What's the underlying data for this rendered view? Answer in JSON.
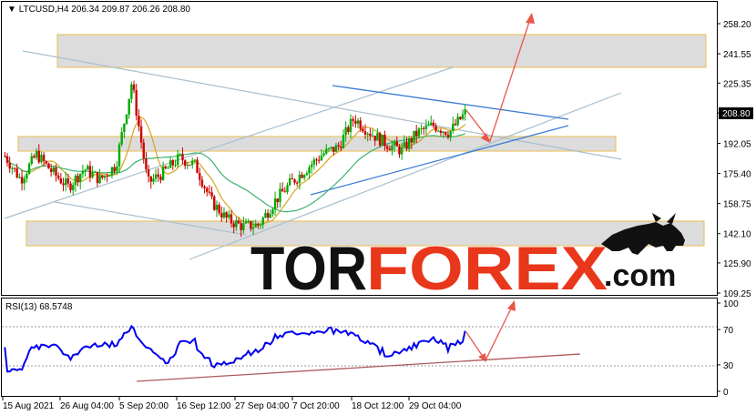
{
  "header": {
    "symbol_line": "LTCUSD,H4  206.34 209.87 206.26 208.80",
    "rsi_label": "RSI(13) 68.5748"
  },
  "price_panel": {
    "y_ticks": [
      "258.20",
      "241.55",
      "225.35",
      "208.80",
      "192.05",
      "175.40",
      "158.75",
      "142.10",
      "125.90",
      "109.25"
    ],
    "current_price": "208.80"
  },
  "rsi_panel": {
    "y_ticks": [
      "100",
      "70",
      "30",
      "0"
    ],
    "levels": [
      70,
      30
    ]
  },
  "x_ticks": [
    "15 Aug 2021",
    "26 Aug 04:00",
    "5 Sep 20:00",
    "16 Sep 12:00",
    "27 Sep 04:00",
    "7 Oct 20:00",
    "18 Oct 12:00",
    "29 Oct 04:00"
  ],
  "watermark": {
    "part1": "TOR",
    "part2": "FOREX",
    "part3": ".com"
  },
  "colors": {
    "bull": "#00aa00",
    "bear": "#cc0000",
    "ma_fast": "#d9a520",
    "ma_slow": "#3cb371",
    "channel": "#a8bfcf",
    "trend_blue": "#3a7bd5",
    "arrow": "#e8574a",
    "zone_fill": "#dcdcdc",
    "zone_border": "#e8c46a",
    "rsi_line": "#0000ee",
    "rsi_trend": "#b05a5a",
    "logo_dark": "#111111",
    "logo_red": "#e8371a"
  },
  "chart_data": {
    "type": "candlestick",
    "symbol": "LTCUSD",
    "timeframe": "H4",
    "ohlc_last": {
      "open": 206.34,
      "high": 209.87,
      "low": 206.26,
      "close": 208.8
    },
    "x": [
      "15 Aug 2021",
      "26 Aug 04:00",
      "5 Sep 20:00",
      "16 Sep 12:00",
      "27 Sep 04:00",
      "7 Oct 20:00",
      "18 Oct 12:00",
      "29 Oct 04:00"
    ],
    "close_approx": [
      185,
      172,
      186,
      176,
      168,
      178,
      172,
      180,
      226,
      170,
      176,
      184,
      180,
      160,
      150,
      146,
      147,
      160,
      170,
      178,
      186,
      190,
      206,
      198,
      192,
      188,
      198,
      202,
      198,
      208.8
    ],
    "ylim": [
      109.25,
      258.2
    ],
    "resistance_zones": [
      [
        235.5,
        257.6
      ],
      [
        187.8,
        196.3
      ],
      [
        136.0,
        147.7
      ]
    ],
    "rsi": {
      "period": 13,
      "last": 68.5748,
      "ylim": [
        0,
        100
      ],
      "levels": [
        70,
        30
      ]
    }
  }
}
